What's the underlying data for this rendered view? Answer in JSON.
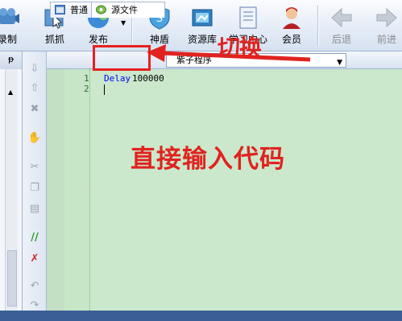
{
  "toolbar": {
    "items": [
      {
        "label": "录制",
        "icon": "record-icon"
      },
      {
        "label": "抓抓",
        "icon": "grab-icon"
      },
      {
        "label": "发布",
        "icon": "publish-icon"
      },
      {
        "label": "神盾",
        "icon": "shield-icon"
      },
      {
        "label": "资源库",
        "icon": "resource-library-icon"
      },
      {
        "label": "学习中心",
        "icon": "learning-center-icon"
      },
      {
        "label": "会员",
        "icon": "member-icon"
      },
      {
        "label": "后退",
        "icon": "back-arrow-icon"
      },
      {
        "label": "前进",
        "icon": "forward-arrow-icon"
      }
    ]
  },
  "left_panel": {
    "pin_glyph": "ᵽ"
  },
  "tabs": [
    {
      "label": "普通",
      "icon": "normal-view-icon"
    },
    {
      "label": "源文件",
      "icon": "source-file-icon"
    }
  ],
  "combo": {
    "value": "紫子程序"
  },
  "editor": {
    "lines": [
      {
        "number": "1",
        "keyword": "Delay",
        "arg": " 100000"
      },
      {
        "number": "2",
        "keyword": "",
        "arg": ""
      }
    ]
  },
  "annotations": {
    "switch_text": "切换",
    "direct_input_text": "直接输入代码"
  },
  "colors": {
    "accent_red": "#e0231f",
    "editor_bg": "#cbe8cc",
    "keyword_blue": "#0000ff"
  }
}
